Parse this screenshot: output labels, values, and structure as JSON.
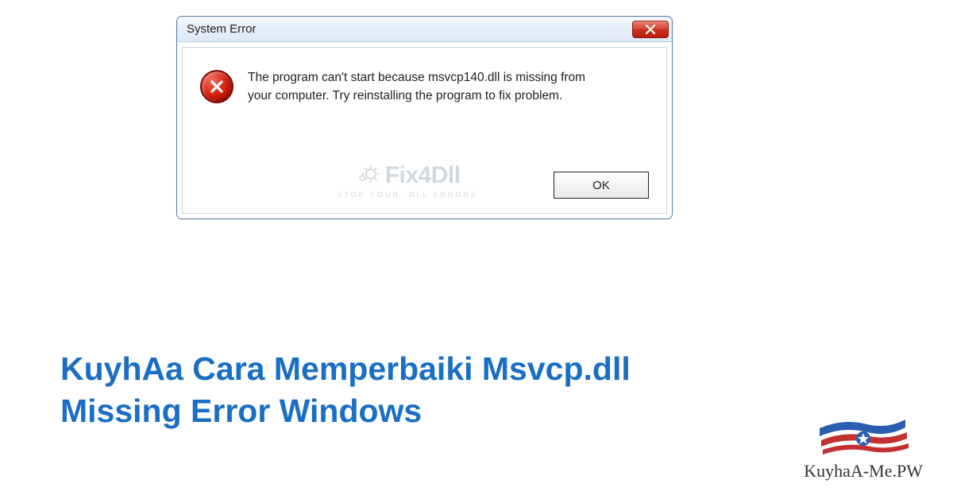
{
  "dialog": {
    "title": "System Error",
    "message": "The program can't start because msvcp140.dll is missing from your computer. Try reinstalling the program to fix problem.",
    "ok_label": "OK"
  },
  "watermark": {
    "brand": "Fix4Dll",
    "tagline": "STOP YOUR .DLL ERRORS"
  },
  "article": {
    "heading": "KuyhAa Cara Memperbaiki Msvcp.dll Missing Error Windows"
  },
  "site": {
    "name": "KuyhaA-Me.PW"
  }
}
